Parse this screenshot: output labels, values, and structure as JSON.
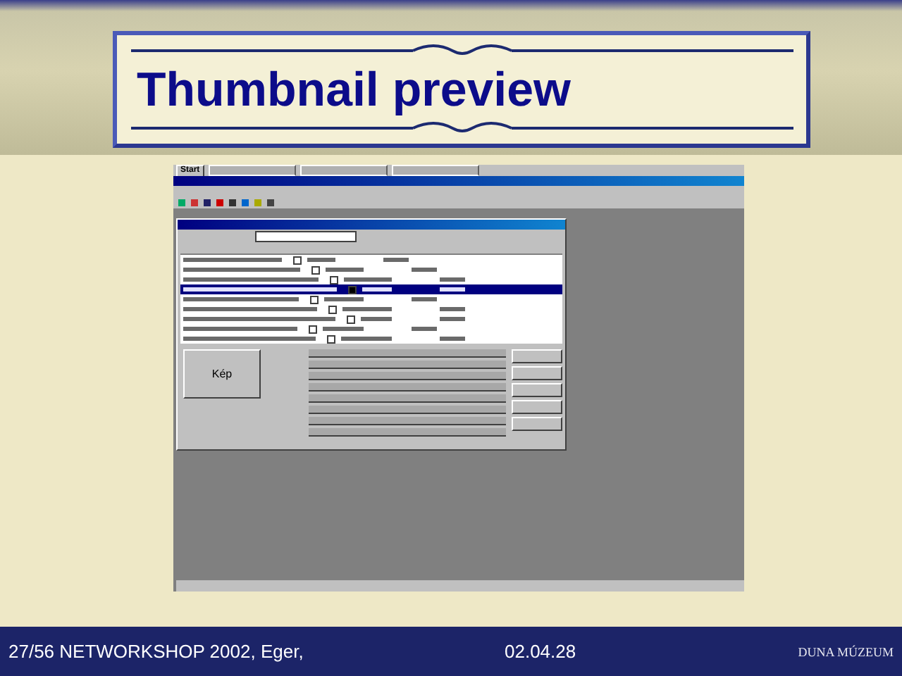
{
  "slide": {
    "title": "Thumbnail preview"
  },
  "screenshot": {
    "taskbar": {
      "start_label": "Start"
    },
    "dialog": {
      "rows": [
        {
          "selected": false
        },
        {
          "selected": false
        },
        {
          "selected": false
        },
        {
          "selected": true
        },
        {
          "selected": false
        },
        {
          "selected": false
        },
        {
          "selected": false
        },
        {
          "selected": false
        },
        {
          "selected": false
        }
      ],
      "image_button": "Kép"
    }
  },
  "footer": {
    "left": "27/56 NETWORKSHOP 2002, Eger,",
    "date": "02.04.28",
    "logo": "DUNA MÚZEUM"
  }
}
